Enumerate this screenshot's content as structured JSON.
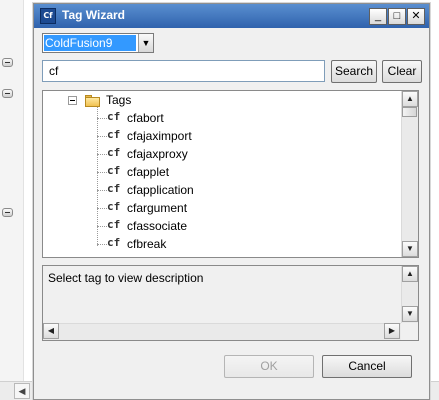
{
  "window": {
    "title": "Tag Wizard",
    "icon_text": "Cf",
    "minimize_label": "_",
    "maximize_label": "□",
    "close_label": "✕"
  },
  "language_select": {
    "selected": "ColdFusion9",
    "arrow": "▼"
  },
  "search": {
    "value": "cf",
    "search_label": "Search",
    "clear_label": "Clear"
  },
  "tree": {
    "root_label": "Tags",
    "icon_text": "cf",
    "items": [
      {
        "label": "cfabort"
      },
      {
        "label": "cfajaximport"
      },
      {
        "label": "cfajaxproxy"
      },
      {
        "label": "cfapplet"
      },
      {
        "label": "cfapplication"
      },
      {
        "label": "cfargument"
      },
      {
        "label": "cfassociate"
      },
      {
        "label": "cfbreak"
      }
    ]
  },
  "description": {
    "text": "Select tag to view description"
  },
  "buttons": {
    "ok_label": "OK",
    "cancel_label": "Cancel"
  },
  "scroll_arrows": {
    "up": "▲",
    "down": "▼",
    "left": "◀",
    "right": "▶"
  }
}
